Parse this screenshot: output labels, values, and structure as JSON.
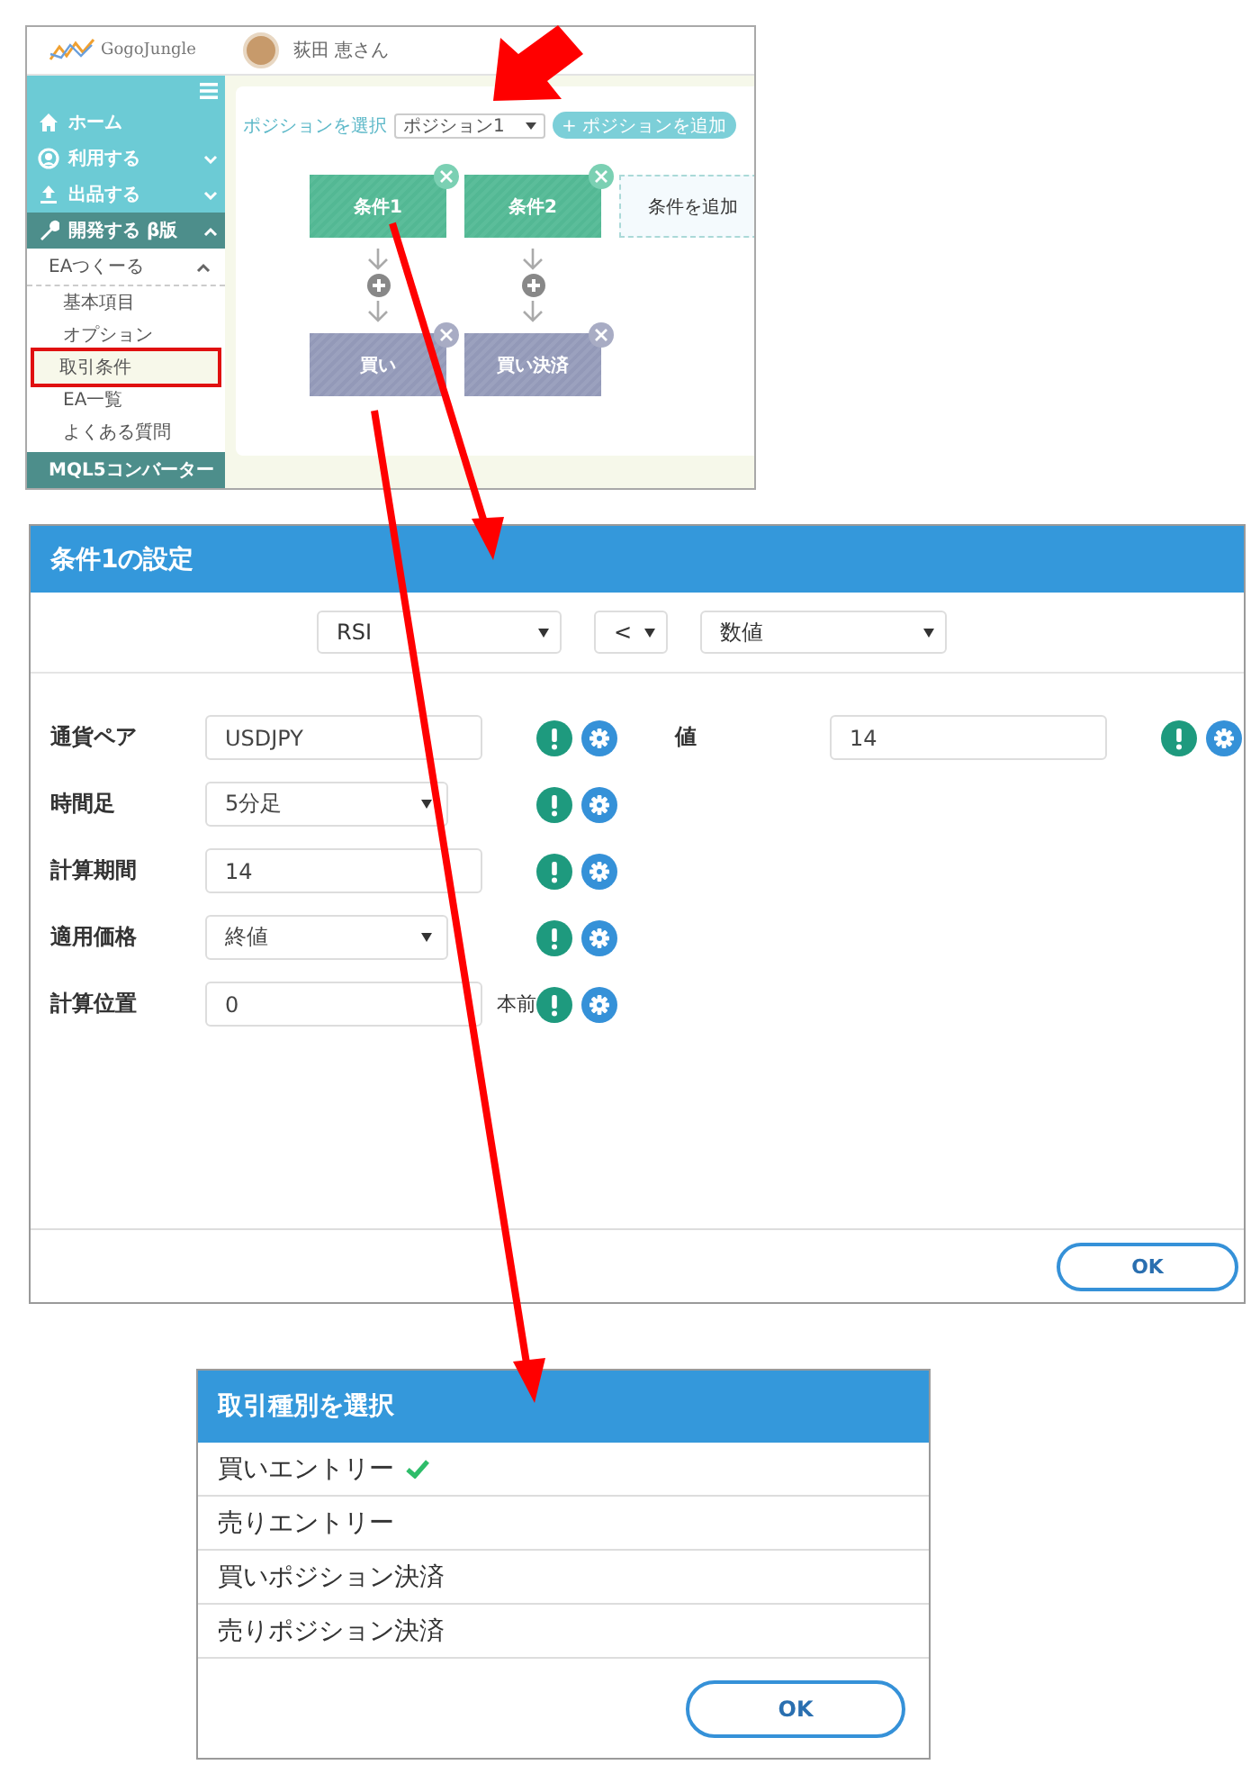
{
  "editor": {
    "logo": "GogoJungle",
    "user": "荻田 恵さん",
    "sidebar": {
      "items": [
        {
          "label": "ホーム",
          "selected": false
        },
        {
          "label": "利用する",
          "expanded": false,
          "selected": false
        },
        {
          "label": "出品する",
          "expanded": false,
          "selected": false
        },
        {
          "label": "開発する β版",
          "expanded": true,
          "selected": true,
          "children": [
            {
              "label": "EAつくーる",
              "expanded": true,
              "children": [
                {
                  "label": "基本項目",
                  "selected": false
                },
                {
                  "label": "オプション",
                  "selected": false
                },
                {
                  "label": "取引条件",
                  "selected": true
                },
                {
                  "label": "EA一覧",
                  "selected": false
                },
                {
                  "label": "よくある質問",
                  "selected": false
                }
              ]
            }
          ]
        },
        {
          "label": "MQL5コンバーター",
          "selected": false
        }
      ]
    },
    "position_label": "ポジションを選択",
    "position_value": "ポジション1",
    "add_position": "+ ポジションを追加",
    "conditions": [
      {
        "label": "条件1"
      },
      {
        "label": "条件2"
      }
    ],
    "add_condition": "条件を追加",
    "actions": [
      {
        "label": "買い"
      },
      {
        "label": "買い決済"
      }
    ]
  },
  "condition_dialog": {
    "title": "条件1の設定",
    "indicator": "RSI",
    "operator": "<",
    "compare": "数値",
    "fields": [
      {
        "label": "通貨ペア",
        "kind": "text",
        "value": "USDJPY"
      },
      {
        "label": "時間足",
        "kind": "select",
        "value": "5分足"
      },
      {
        "label": "計算期間",
        "kind": "text",
        "value": "14"
      },
      {
        "label": "適用価格",
        "kind": "select",
        "value": "終値"
      },
      {
        "label": "計算位置",
        "kind": "text",
        "value": "0",
        "suffix": "本前"
      }
    ],
    "right_fields": [
      {
        "label": "値",
        "kind": "text",
        "value": "14"
      }
    ],
    "ok": "OK"
  },
  "trade_type_dialog": {
    "title": "取引種別を選択",
    "options": [
      {
        "label": "買いエントリー",
        "selected": true
      },
      {
        "label": "売りエントリー",
        "selected": false
      },
      {
        "label": "買いポジション決済",
        "selected": false
      },
      {
        "label": "売りポジション決済",
        "selected": false
      }
    ],
    "ok": "OK"
  }
}
